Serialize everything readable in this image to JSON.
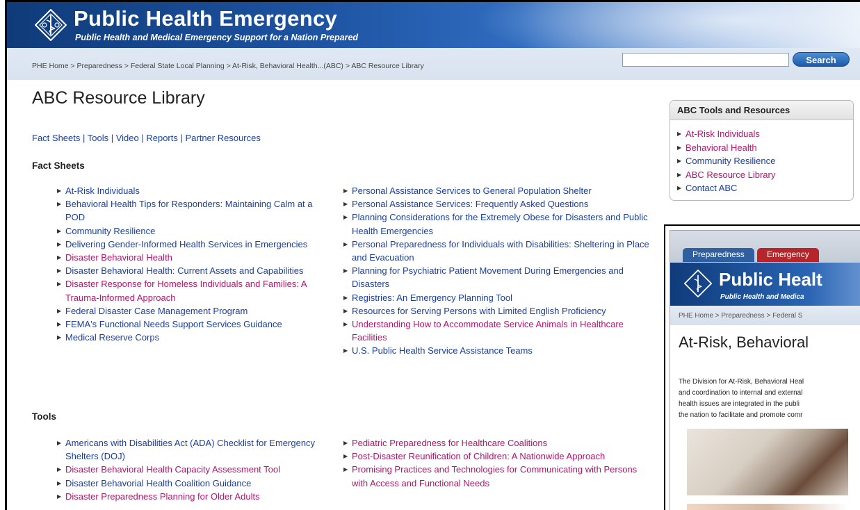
{
  "header": {
    "title": "Public Health Emergency",
    "tagline": "Public Health and Medical Emergency Support for a Nation Prepared",
    "search_placeholder": "",
    "search_label": "Search",
    "breadcrumb": "PHE Home > Preparedness > Federal State Local Planning > At-Risk, Behavioral Health...(ABC) > ABC Resource Library"
  },
  "main": {
    "title": "ABC Resource Library",
    "quicklinks": [
      "Fact Sheets",
      "Tools",
      "Video",
      "Reports",
      "Partner Resources"
    ],
    "sections": {
      "fact_sheets": {
        "heading": "Fact Sheets",
        "left": [
          {
            "label": "At-Risk Individuals",
            "visited": false
          },
          {
            "label": "Behavioral Health Tips for Responders: Maintaining Calm at a POD",
            "visited": false
          },
          {
            "label": "Community Resilience",
            "visited": false
          },
          {
            "label": "Delivering Gender-Informed Health Services in Emergencies",
            "visited": false
          },
          {
            "label": "Disaster Behavioral Health",
            "visited": true
          },
          {
            "label": "Disaster Behavioral Health: Current Assets and Capabilities",
            "visited": false
          },
          {
            "label": "Disaster Response for Homeless Individuals and Families: A Trauma-Informed Approach",
            "visited": true
          },
          {
            "label": "Federal Disaster Case Management Program",
            "visited": false
          },
          {
            "label": "FEMA's Functional Needs Support Services Guidance",
            "visited": false
          },
          {
            "label": "Medical Reserve Corps",
            "visited": false
          }
        ],
        "right": [
          {
            "label": "Personal Assistance Services to General Population Shelter",
            "visited": false
          },
          {
            "label": "Personal Assistance Services:  Frequently Asked Questions",
            "visited": false
          },
          {
            "label": "Planning Considerations for the Extremely Obese for Disasters and Public Health Emergencies",
            "visited": false
          },
          {
            "label": "Personal Preparedness for Individuals with Disabilities: Sheltering in Place and Evacuation",
            "visited": false
          },
          {
            "label": "Planning for Psychiatric Patient Movement During Emergencies and Disasters",
            "visited": false
          },
          {
            "label": "Registries: An Emergency Planning Tool",
            "visited": false
          },
          {
            "label": "Resources for Serving Persons with Limited English Proficiency",
            "visited": false
          },
          {
            "label": "Understanding How to Accommodate Service Animals in Healthcare Facilities",
            "visited": true
          },
          {
            "label": "U.S. Public Health Service Assistance Teams",
            "visited": false
          }
        ]
      },
      "tools": {
        "heading": "Tools",
        "left": [
          {
            "label": "Americans with Disabilities Act (ADA) Checklist for Emergency Shelters (DOJ)",
            "visited": false
          },
          {
            "label": "Disaster Behavioral Health Capacity Assessment Tool",
            "visited": true
          },
          {
            "label": "Disaster Behavorial Health Coalition Guidance",
            "visited": false
          },
          {
            "label": "Disaster Preparedness Planning for Older Adults",
            "visited": true
          }
        ],
        "right": [
          {
            "label": "Pediatric Preparedness for Healthcare Coalitions",
            "visited": true
          },
          {
            "label": "Post-Disaster Reunification of Children:  A Nationwide Approach",
            "visited": true
          },
          {
            "label": "Promising Practices and Technologies for Communicating with Persons with Access and Functional Needs",
            "visited": true
          }
        ]
      }
    }
  },
  "sidebar": {
    "heading": "ABC Tools and Resources",
    "items": [
      {
        "label": "At-Risk Individuals",
        "visited": true
      },
      {
        "label": "Behavioral Health",
        "visited": true
      },
      {
        "label": "Community Resilience",
        "visited": false
      },
      {
        "label": "ABC Resource Library",
        "visited": true
      },
      {
        "label": "Contact ABC",
        "visited": false
      }
    ]
  },
  "thumbnail": {
    "tabs": [
      "Preparedness",
      "Emergency"
    ],
    "title": "Public Healt",
    "tagline": "Public Health and Medica",
    "breadcrumb": "PHE Home > Preparedness > Federal S",
    "heading": "At-Risk, Behavioral",
    "paragraph": [
      "The Division for At-Risk, Behavioral Heal",
      "and coordination to internal and external",
      "health issues are integrated in the publi",
      "the nation to facilitate and promote comr"
    ]
  },
  "colors": {
    "link": "#1a3fa0",
    "visited": "#b5146e",
    "banner": "#1d52a0"
  }
}
